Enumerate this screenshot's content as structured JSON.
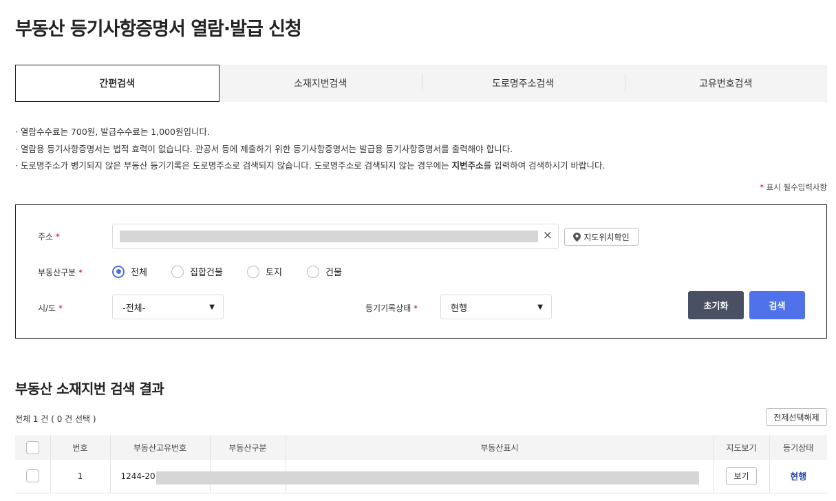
{
  "title": "부동산 등기사항증명서 열람·발급 신청",
  "tabs": [
    "간편검색",
    "소재지번검색",
    "도로명주소검색",
    "고유번호검색"
  ],
  "notes": [
    "· 열람수수료는  700원, 발급수수료는  1,000원입니다.",
    "· 열람용 등기사항증명서는 법적 효력이 없습니다. 관공서 등에 제출하기 위한 등기사항증명서는 발급용 등기사항증명서를 출력해야 합니다.",
    "· 도로명주소가 병기되지 않은 부동산 등기기록은 도로명주소로 검색되지 않습니다. 도로명주소로 검색되지 않는 경우에는 ",
    "지번주소",
    "를 입력하여 검색하시기 바랍니다."
  ],
  "required_note": {
    "star": "*",
    "text": " 표시 필수입력사항"
  },
  "form": {
    "address_label": "주소",
    "star": "*",
    "clear": "×",
    "map_button": "지도위치확인",
    "type_label": "부동산구분",
    "types": [
      "전체",
      "집합건물",
      "토지",
      "건물"
    ],
    "type_selected": "전체",
    "sido_label": "시/도",
    "sido_value": "-전체-",
    "status_label": "등기기록상태",
    "status_value": "현행",
    "reset": "초기화",
    "search": "검색"
  },
  "results": {
    "title": "부동산 소재지번 검색 결과",
    "count": "전체 1 건 ( 0 건 선택 )",
    "deselect_all": "전제선택해제",
    "headers": [
      "번호",
      "부동산고유번호",
      "부동산구분",
      "부동산표시",
      "지도보기",
      "등기상태"
    ],
    "rows": [
      {
        "no": "1",
        "id": "1244-20",
        "view": "보기",
        "status": "현행"
      }
    ]
  },
  "colors": {
    "primary": "#4a6ee0",
    "dark": "#4a5063",
    "status": "#2e4aa8"
  }
}
